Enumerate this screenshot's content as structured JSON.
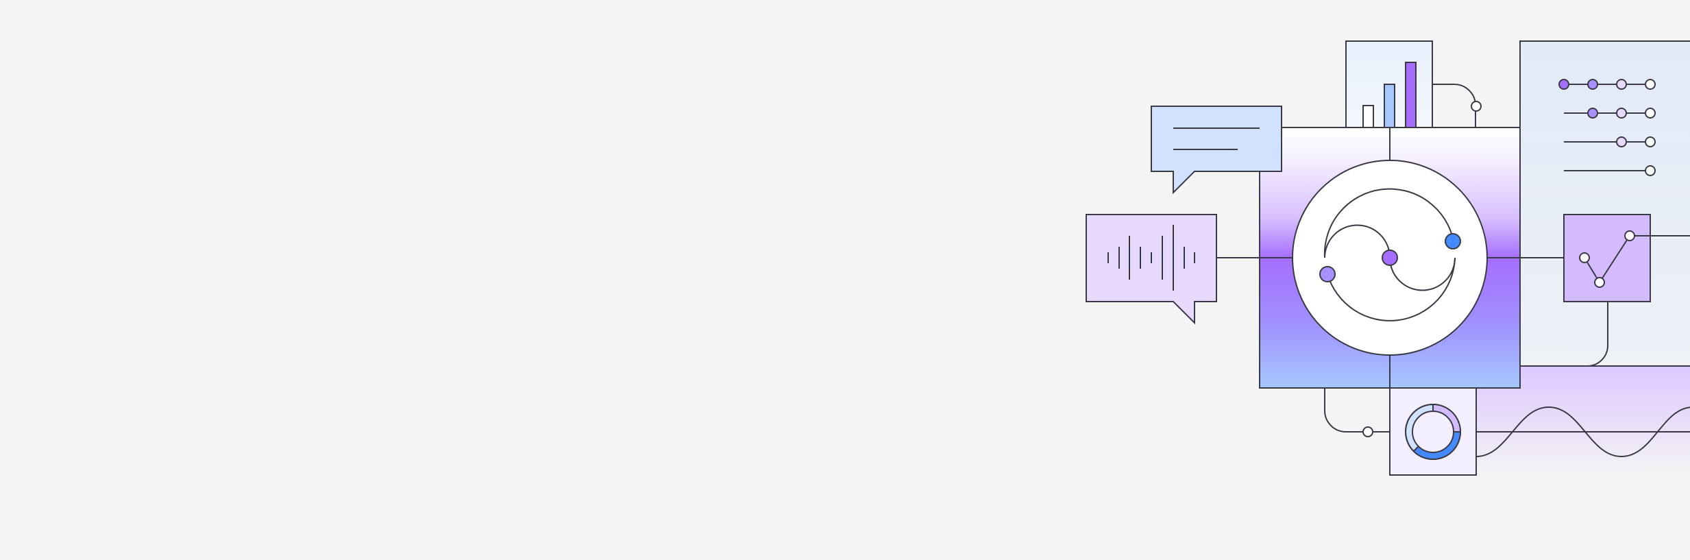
{
  "page": {
    "background": "#f4f4f4"
  },
  "illustration": {
    "palette": {
      "stroke": "#3a3a44",
      "purple": "#a56eff",
      "light_purple": "#d4bbff",
      "pale_purple": "#e8daff",
      "blue": "#4589ff",
      "light_blue": "#a6c8ff",
      "pale_blue": "#d0e2ff",
      "panel_blue": "#e5ecf8"
    },
    "icons": [
      "chat-bubble-icon",
      "audio-waveform-icon",
      "bar-chart-icon",
      "sync-cycle-icon",
      "donut-chart-icon",
      "slider-controls-icon",
      "line-graph-icon",
      "sine-wave-icon"
    ]
  }
}
